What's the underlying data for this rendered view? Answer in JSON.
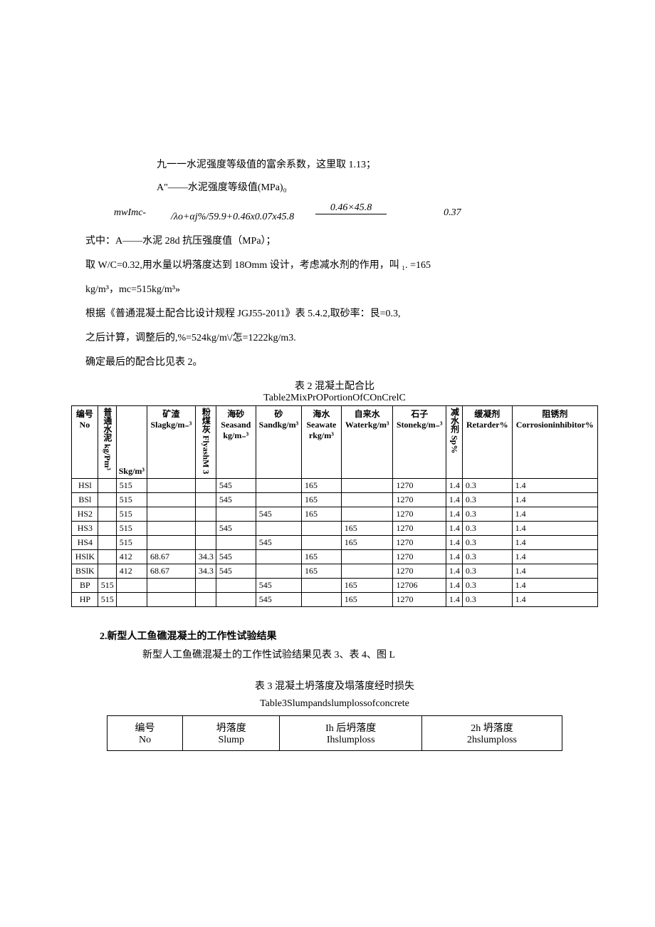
{
  "intro": {
    "line1": "九一一水泥强度等级值的富余系数，这里取 1.13；",
    "line2": "A\"——水泥强度等级值(MPa)₀"
  },
  "formula": {
    "left": "mwImc-",
    "num": "0.46×45.8",
    "denom": "/λo+αj%/59.9+0.46x0.07x45.8",
    "right": "0.37"
  },
  "paragraphs": {
    "p1": "式中：A——水泥 28d 抗压强度值（MPa）；",
    "p2": "取 W/C=0.32,用水量以坍落度达到 18Omm 设计，考虑减水剂的作用，叫 ₁. =165",
    "p3": "kg/m³，mc=515kg/m³»",
    "p4": "根据《普通混凝土配合比设计规程 JGJ55-2011》表 5.4.2,取砂率：艮=0.3,",
    "p5": "之后计算，调整后的,%=524kg/m\\/怎=1222kg/m3.",
    "p6": "确定最后的配合比见表 2。"
  },
  "table2": {
    "caption_cn": "表 2 混凝土配合比",
    "caption_en": "Table2MixPrOPortionOfCOnCrelC",
    "headers": {
      "no": "编号 No",
      "putong": "普通水泥 kg/Pm³",
      "skg": "Skg/m³",
      "slag": "矿渣 Slagkg/m₋³",
      "flyash": "粉煤灰 FlyashM 3",
      "seasand": "海砂 Seasand kg/m₋³",
      "sand": "砂 Sandkg/m³",
      "seawater": "海水 Seawate rkg/m³",
      "water": "自来水 Waterkg/m³",
      "stone": "石子 Stonekg/m₋³",
      "sp": "减水剂 Sp%",
      "retarder": "缓凝剂 Retarder%",
      "corr": "阻锈剂 Corrosioninhibitor%"
    },
    "rows": [
      {
        "no": "HSl",
        "pt": "",
        "skg": "515",
        "slag": "",
        "fly": "",
        "sea": "545",
        "sand": "",
        "seaw": "165",
        "wat": "",
        "stone": "1270",
        "sp": "1.4",
        "ret": "0.3",
        "corr": "1.4"
      },
      {
        "no": "BSl",
        "pt": "",
        "skg": "515",
        "slag": "",
        "fly": "",
        "sea": "545",
        "sand": "",
        "seaw": "165",
        "wat": "",
        "stone": "1270",
        "sp": "1.4",
        "ret": "0.3",
        "corr": "1.4"
      },
      {
        "no": "HS2",
        "pt": "",
        "skg": "515",
        "slag": "",
        "fly": "",
        "sea": "",
        "sand": "545",
        "seaw": "165",
        "wat": "",
        "stone": "1270",
        "sp": "1.4",
        "ret": "0.3",
        "corr": "1.4"
      },
      {
        "no": "HS3",
        "pt": "",
        "skg": "515",
        "slag": "",
        "fly": "",
        "sea": "545",
        "sand": "",
        "seaw": "",
        "wat": "165",
        "stone": "1270",
        "sp": "1.4",
        "ret": "0.3",
        "corr": "1.4"
      },
      {
        "no": "HS4",
        "pt": "",
        "skg": "515",
        "slag": "",
        "fly": "",
        "sea": "",
        "sand": "545",
        "seaw": "",
        "wat": "165",
        "stone": "1270",
        "sp": "1.4",
        "ret": "0.3",
        "corr": "1.4"
      },
      {
        "no": "HSlK",
        "pt": "",
        "skg": "412",
        "slag": "68.67",
        "fly": "34.3",
        "sea": "545",
        "sand": "",
        "seaw": "165",
        "wat": "",
        "stone": "1270",
        "sp": "1.4",
        "ret": "0.3",
        "corr": "1.4"
      },
      {
        "no": "BSlK",
        "pt": "",
        "skg": "412",
        "slag": "68.67",
        "fly": "34.3",
        "sea": "545",
        "sand": "",
        "seaw": "165",
        "wat": "",
        "stone": "1270",
        "sp": "1.4",
        "ret": "0.3",
        "corr": "1.4"
      },
      {
        "no": "BP",
        "pt": "515",
        "skg": "",
        "slag": "",
        "fly": "",
        "sea": "",
        "sand": "545",
        "seaw": "",
        "wat": "165",
        "stone": "12706",
        "sp": "1.4",
        "ret": "0.3",
        "corr": "1.4"
      },
      {
        "no": "HP",
        "pt": "515",
        "skg": "",
        "slag": "",
        "fly": "",
        "sea": "",
        "sand": "545",
        "seaw": "",
        "wat": "165",
        "stone": "1270",
        "sp": "1.4",
        "ret": "0.3",
        "corr": "1.4"
      }
    ]
  },
  "section2": {
    "heading": "2.新型人工鱼礁混凝土的工作性试验结果",
    "line": "新型人工鱼礁混凝土的工作性试验结果见表 3、表 4、图 L"
  },
  "table3": {
    "caption_cn": "表 3 混凝土坍落度及塌落度经时损失",
    "caption_en": "Table3Slumpandslumplossofconcrete",
    "headers": {
      "no_cn": "编号",
      "no_en": "No",
      "slump_cn": "坍落度",
      "slump_en": "Slump",
      "h1_cn": "Ih 后坍落度",
      "h1_en": "Ihslumploss",
      "h2_cn": "2h 坍落度",
      "h2_en": "2hslumploss"
    }
  }
}
